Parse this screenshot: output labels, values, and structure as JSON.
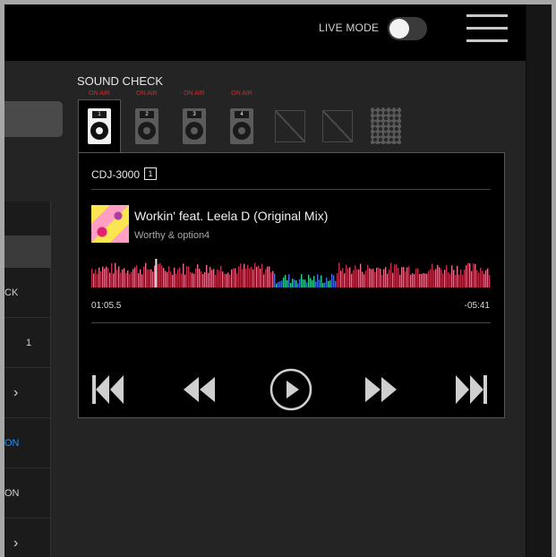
{
  "header": {
    "live_mode_label": "LIVE MODE",
    "live_mode_on": false
  },
  "left_panel": {
    "rows": [
      {
        "text": "CK",
        "kind": "text"
      },
      {
        "text": "1",
        "kind": "text"
      },
      {
        "text": "›",
        "kind": "chevron"
      },
      {
        "text": "ON",
        "kind": "blue"
      },
      {
        "text": "ON",
        "kind": "text"
      },
      {
        "text": "›",
        "kind": "chevron"
      }
    ]
  },
  "sound_check": {
    "title": "SOUND CHECK",
    "decks": [
      {
        "number": "1",
        "on_air": "ON AIR",
        "active": true
      },
      {
        "number": "2",
        "on_air": "ON AIR",
        "active": false
      },
      {
        "number": "3",
        "on_air": "ON AIR",
        "active": false
      },
      {
        "number": "4",
        "on_air": "ON AIR",
        "active": false
      }
    ]
  },
  "player": {
    "model": "CDJ-3000",
    "deck_number": "1",
    "track_title": "Workin' feat. Leela D (Original Mix)",
    "artist": "Worthy & option4",
    "time_elapsed": "01:05.5",
    "time_remaining": "-05:41",
    "playhead_fraction": 0.16,
    "icons": {
      "prev": "skip-previous-icon",
      "rewind": "rewind-icon",
      "play": "play-icon",
      "forward": "fast-forward-icon",
      "next": "skip-next-icon"
    }
  },
  "colors": {
    "onair_red": "#d22a2a",
    "wave_red": "#c0304a",
    "wave_pink": "#e8708a",
    "wave_blue": "#4a6ae0",
    "wave_green": "#2ad090",
    "accent_blue": "#1e90ff"
  }
}
